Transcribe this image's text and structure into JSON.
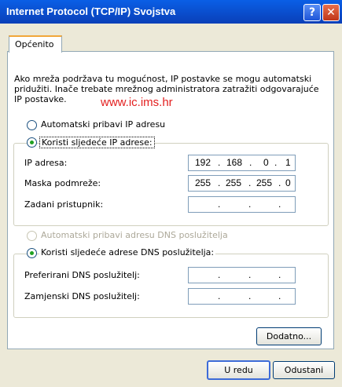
{
  "window": {
    "title": "Internet Protocol (TCP/IP) Svojstva",
    "help_label": "?",
    "close_label": "✕"
  },
  "tab": {
    "label": "Općenito"
  },
  "intro": "Ako mreža podržava tu mogućnost, IP postavke se mogu automatski pridužiti. Inače trebate mrežnog administratora zatražiti odgovarajuće IP postavke.",
  "watermark": "www.ic.ims.hr",
  "ip_section": {
    "auto_label": "Automatski pribavi IP adresu",
    "manual_label": "Koristi sljedeće IP adrese:",
    "ip_label": "IP adresa:",
    "mask_label": "Maska podmreže:",
    "gateway_label": "Zadani pristupnik:",
    "ip": [
      "192",
      "168",
      "0",
      "1"
    ],
    "mask": [
      "255",
      "255",
      "255",
      "0"
    ],
    "gateway": [
      "",
      "",
      "",
      ""
    ],
    "dot": "."
  },
  "dns_section": {
    "auto_label": "Automatski pribavi adresu DNS poslužitelja",
    "manual_label": "Koristi sljedeće adrese DNS poslužitelja:",
    "preferred_label": "Preferirani DNS poslužitelj:",
    "alternate_label": "Zamjenski DNS poslužitelj:",
    "preferred": [
      "",
      "",
      "",
      ""
    ],
    "alternate": [
      "",
      "",
      "",
      ""
    ]
  },
  "buttons": {
    "advanced": "Dodatno...",
    "ok": "U redu",
    "cancel": "Odustani"
  }
}
